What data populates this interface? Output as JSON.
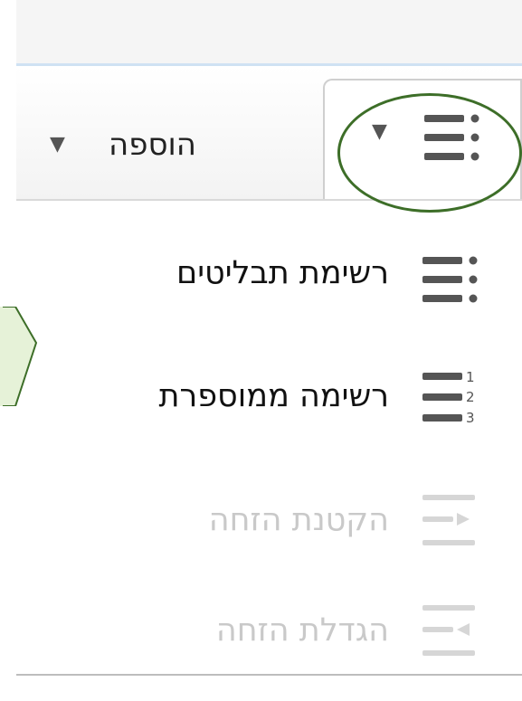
{
  "toolbar": {
    "add_label": "הוספה",
    "dropdown_arrow": "▼",
    "list_arrow": "▼",
    "list_icon": "bulleted-list-icon"
  },
  "menu": {
    "items": [
      {
        "label": "רשימת תבליטים",
        "icon": "bulleted-list-icon",
        "enabled": true
      },
      {
        "label": "רשימה ממוספרת",
        "icon": "numbered-list-icon",
        "enabled": true
      },
      {
        "label": "הקטנת הזחה",
        "icon": "decrease-indent-icon",
        "enabled": false
      },
      {
        "label": "הגדלת הזחה",
        "icon": "increase-indent-icon",
        "enabled": false
      }
    ]
  },
  "colors": {
    "highlight": "#3d6e28",
    "callout_fill": "#e6f2d8",
    "disabled_text": "#c9c9c9",
    "icon": "#555555"
  }
}
